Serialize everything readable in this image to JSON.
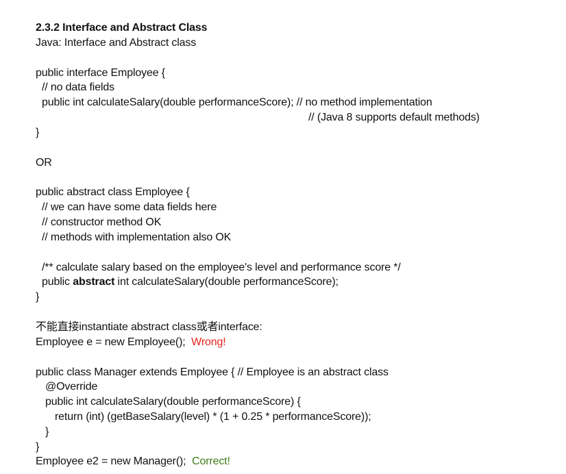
{
  "doc": {
    "title": "2.3.2 Interface and Abstract Class",
    "subtitle": "Java: Interface and Abstract class",
    "interface_block": {
      "l1": "public interface Employee {",
      "l2": "// no data fields",
      "l3": "public int calculateSalary(double performanceScore); // no method implementation",
      "l4": "// (Java 8 supports default methods)",
      "l5": "}"
    },
    "or": "OR",
    "abstract_block": {
      "l1": "public abstract class Employee {",
      "l2": "// we can have some data fields here",
      "l3": "// constructor method OK",
      "l4": "// methods with implementation also OK",
      "l5": "/** calculate salary based on the employee's level and performance score */",
      "l6_pre": "public ",
      "l6_kw": "abstract",
      "l6_post": " int calculateSalary(double performanceScore);",
      "l7": "}"
    },
    "note": "不能直接instantiate abstract class或者interface:",
    "wrong_line": {
      "code": "Employee e = new Employee();  ",
      "verdict": "Wrong!"
    },
    "manager_block": {
      "l1": "public class Manager extends Employee { // Employee is an abstract class",
      "l2": "@Override",
      "l3": "public int calculateSalary(double performanceScore) {",
      "l4": "return (int) (getBaseSalary(level) * (1 + 0.25 * performanceScore));",
      "l5": "}",
      "l6": "}"
    },
    "correct_line": {
      "code": "Employee e2 = new Manager();  ",
      "verdict": "Correct!"
    }
  },
  "colors": {
    "text": "#111111",
    "wrong": "#e8231b",
    "correct": "#3f7d1d"
  }
}
